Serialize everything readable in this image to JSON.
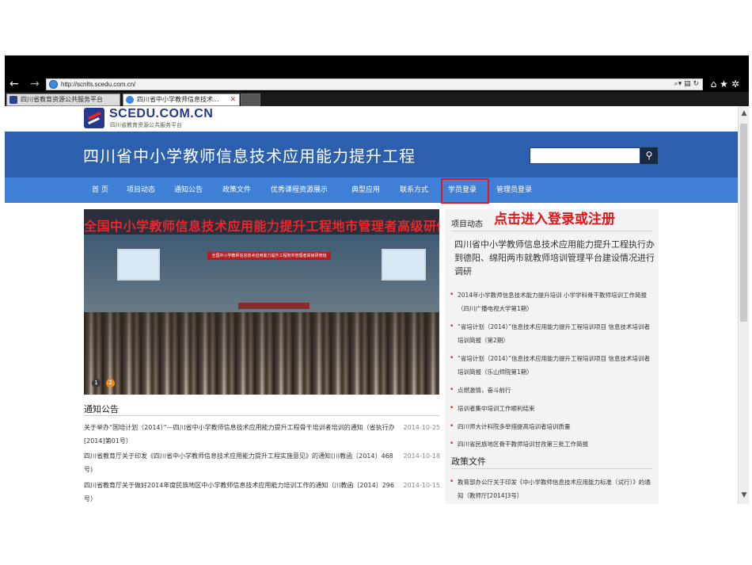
{
  "browser": {
    "url": "http://scnlts.scedu.com.cn/",
    "tabs": [
      {
        "label": "四川省教育资源公共服务平台"
      },
      {
        "label": "四川省中小学教师信息技术..."
      }
    ]
  },
  "site": {
    "logo_text": "SCEDU.COM.CN",
    "logo_subtitle": "四川省教育资源公共服务平台",
    "banner_title": "四川省中小学教师信息技术应用能力提升工程"
  },
  "nav": {
    "items": [
      "首 页",
      "项目动态",
      "通知公告",
      "政策文件",
      "优秀课程资源展示",
      "典型应用",
      "联系方式",
      "学员登录",
      "管理员登录"
    ]
  },
  "slider": {
    "title": "全国中小学教师信息技术应用能力提升工程地市管理者高级研修班",
    "stage_banner": "全国中小学教师信息技术应用能力提升工程地市管理者高级研修班",
    "dots": [
      "1",
      "2"
    ]
  },
  "notices": {
    "heading": "通知公告",
    "items": [
      {
        "title": "关于举办“国培计划（2014）”—四川省中小学教师信息技术应用能力提升工程骨干培训者培训的通知（省执行办[2014]第01号）",
        "date": "2014-10-25"
      },
      {
        "title": "四川省教育厅关于印发《四川省中小学教师信息技术应用能力提升工程实施意见》的通知(川教函〔2014〕468 号)",
        "date": "2014-10-18"
      },
      {
        "title": "四川省教育厅关于做好2014年度民族地区中小学教师信息技术应用能力培训工作的通知（川教函〔2014〕296号）",
        "date": "2014-10-15"
      }
    ]
  },
  "projects": {
    "heading": "项目动态",
    "callout": "点击进入登录或注册",
    "featured": "四川省中小学教师信息技术应用能力提升工程执行办到德阳、绵阳两市就教师培训管理平台建设情况进行调研",
    "items": [
      "2014年小学教师信息技术能力提升培训 小学学科骨干教师培训工作简报（四川广播电视大学第1期）",
      "“省培计划（2014）”信息技术应用能力提升工程培训项目 信息技术培训者培训简报（第2期）",
      "“省培计划（2014）”信息技术应用能力提升工程培训项目 信息技术培训者培训简报（乐山师院第1期）",
      "点燃激情，奋斗前行",
      "培训者集中培训工作顺利结束",
      "四川师大计科院多举措提高培训者培训质量",
      "四川省民族地区骨干教师培训甘孜第三批工作简报"
    ]
  },
  "policy": {
    "heading": "政策文件",
    "items": [
      "教育部办公厅关于印发《中小学教师信息技术应用能力标准（试行）》的通知（教师厅[2014]3号）"
    ]
  }
}
